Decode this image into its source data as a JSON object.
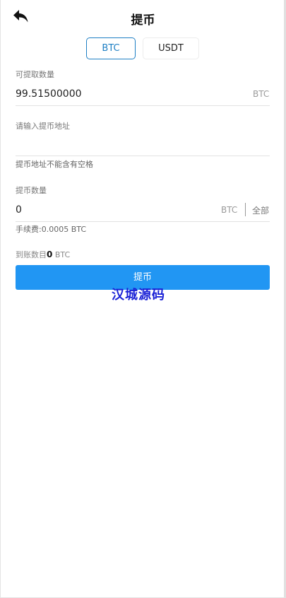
{
  "header": {
    "title": "提币",
    "back_icon": "back-arrow-icon"
  },
  "tabs": [
    {
      "label": "BTC",
      "active": true
    },
    {
      "label": "USDT",
      "active": false
    }
  ],
  "available": {
    "label": "可提取数量",
    "value": "99.51500000",
    "unit": "BTC"
  },
  "address": {
    "label": "请输入提币地址",
    "value": "",
    "hint": "提币地址不能含有空格"
  },
  "amount": {
    "label": "提币数量",
    "value": "0",
    "unit": "BTC",
    "all_label": "全部",
    "fee_text": "手续费:0.0005 BTC"
  },
  "arrival": {
    "label": "到账数目",
    "value": "0",
    "unit": "BTC"
  },
  "submit_label": "提币",
  "watermark": "汉城源码",
  "colors": {
    "accent": "#2196f3",
    "tab_active": "#1e7fc4",
    "watermark": "#1a21d6"
  }
}
